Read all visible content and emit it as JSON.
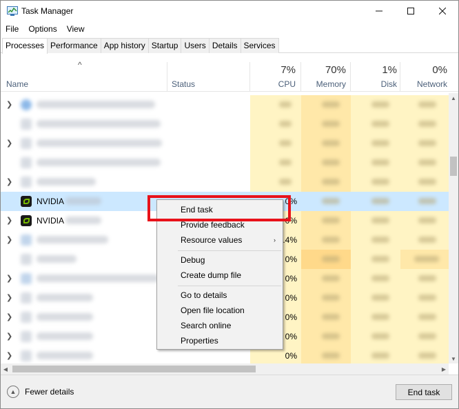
{
  "window": {
    "title": "Task Manager",
    "app_icon": "task-manager-icon"
  },
  "title_buttons": {
    "minimize": "—",
    "maximize": "☐",
    "close": "✕"
  },
  "menu": [
    "File",
    "Options",
    "View"
  ],
  "tabs": [
    "Processes",
    "Performance",
    "App history",
    "Startup",
    "Users",
    "Details",
    "Services"
  ],
  "active_tab": "Processes",
  "columns": {
    "name": "Name",
    "status": "Status",
    "cpu": {
      "pct": "7%",
      "label": "CPU"
    },
    "memory": {
      "pct": "70%",
      "label": "Memory"
    },
    "disk": {
      "pct": "1%",
      "label": "Disk"
    },
    "network": {
      "pct": "0%",
      "label": "Network"
    }
  },
  "rows": [
    {
      "name": "NVIDIA",
      "cpu": "0%",
      "selected": true
    },
    {
      "name": "NVIDIA",
      "cpu": "0%"
    },
    {
      "cpu": "0.4%"
    },
    {
      "cpu": "0%"
    },
    {
      "cpu": "0%"
    },
    {
      "cpu": "0%"
    },
    {
      "cpu": "0%"
    },
    {
      "cpu": "0%"
    },
    {
      "cpu": "0%"
    }
  ],
  "context_menu": {
    "items": [
      "End task",
      "Provide feedback",
      "Resource values",
      "Debug",
      "Create dump file",
      "Go to details",
      "Open file location",
      "Search online",
      "Properties"
    ],
    "submenu_arrow": "›"
  },
  "footer": {
    "fewer_details": "Fewer details",
    "end_task": "End task"
  },
  "colors": {
    "heat_light": "#fff4c4",
    "heat_medium": "#ffe8a9",
    "selection": "#cce8ff",
    "highlight_box": "#e8121a"
  }
}
